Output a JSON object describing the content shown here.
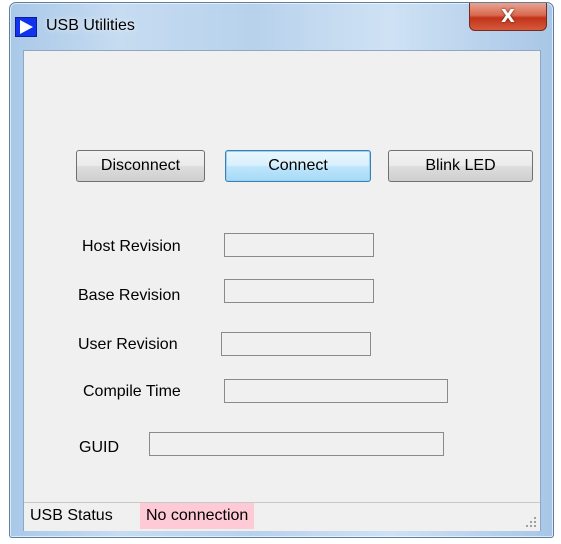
{
  "window": {
    "title": "USB Utilities",
    "close_label": "X"
  },
  "buttons": {
    "disconnect": "Disconnect",
    "connect": "Connect",
    "blink_led": "Blink LED"
  },
  "fields": {
    "host_revision": {
      "label": "Host Revision",
      "value": ""
    },
    "base_revision": {
      "label": "Base Revision",
      "value": ""
    },
    "user_revision": {
      "label": "User Revision",
      "value": ""
    },
    "compile_time": {
      "label": "Compile Time",
      "value": ""
    },
    "guid": {
      "label": "GUID",
      "value": ""
    }
  },
  "status": {
    "label": "USB Status",
    "value": "No connection",
    "value_color": "#fdcad6"
  },
  "icons": {
    "app": "play-triangle-icon",
    "close": "close-icon",
    "grip": "resize-grip-icon"
  }
}
